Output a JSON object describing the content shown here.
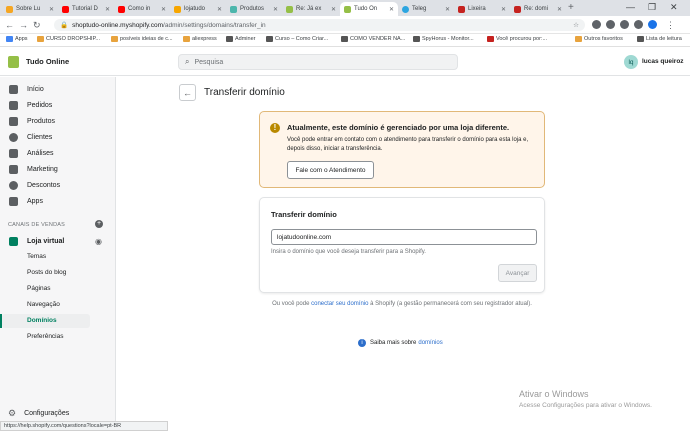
{
  "browser": {
    "tabs": [
      {
        "label": "Sobre Lu",
        "color": "#f5a623"
      },
      {
        "label": "Tutorial D",
        "color": "#ff0000"
      },
      {
        "label": "Como in",
        "color": "#ff0000"
      },
      {
        "label": "lojatudo",
        "color": "#f7a600"
      },
      {
        "label": "Produtos",
        "color": "#4cb6ac"
      },
      {
        "label": "Re: Já ex",
        "color": "#95bf47"
      },
      {
        "label": "Tudo On",
        "color": "#95bf47"
      },
      {
        "label": "Teleg",
        "color": "#2ca5e0"
      },
      {
        "label": "Lixeira",
        "color": "#c5221f"
      },
      {
        "label": "Re: domi",
        "color": "#c5221f"
      }
    ],
    "active_tab_index": 6,
    "url_domain": "shoptudo-online.myshopify.com",
    "url_path": "/admin/settings/domains/transfer_in",
    "bookmarks": [
      {
        "label": "Apps",
        "color": "#4285f4"
      },
      {
        "label": "CURSO DROPSHIP...",
        "color": "#e8a33d"
      },
      {
        "label": "posíveis ideias de c...",
        "color": "#e8a33d"
      },
      {
        "label": "aliexpress",
        "color": "#e8a33d"
      },
      {
        "label": "Adminer",
        "color": "#555555"
      },
      {
        "label": "Curso – Como Criar...",
        "color": "#555555"
      },
      {
        "label": "COMO VENDER NA...",
        "color": "#555555"
      },
      {
        "label": "SpyHorus - Monitor...",
        "color": "#555555"
      },
      {
        "label": "Você procurou por:...",
        "color": "#c5221f"
      },
      {
        "label": "Outros favoritos",
        "color": "#e8a33d"
      },
      {
        "label": "Lista de leitura",
        "color": "#555555"
      }
    ],
    "status_url": "https://help.shopify.com/questions?locale=pt-BR"
  },
  "topbar": {
    "store_name": "Tudo Online",
    "search_placeholder": "Pesquisa",
    "avatar_initials": "lq",
    "user_name": "lucas queiroz"
  },
  "sidebar": {
    "items": [
      {
        "label": "Início",
        "icon": "home-icon"
      },
      {
        "label": "Pedidos",
        "icon": "orders-icon"
      },
      {
        "label": "Produtos",
        "icon": "products-icon"
      },
      {
        "label": "Clientes",
        "icon": "customers-icon"
      },
      {
        "label": "Análises",
        "icon": "analytics-icon"
      },
      {
        "label": "Marketing",
        "icon": "marketing-icon"
      },
      {
        "label": "Descontos",
        "icon": "discounts-icon"
      },
      {
        "label": "Apps",
        "icon": "apps-icon"
      }
    ],
    "section_label": "CANAIS DE VENDAS",
    "channel_label": "Loja virtual",
    "channel_subitems": [
      "Temas",
      "Posts do blog",
      "Páginas",
      "Navegação",
      "Domínios",
      "Preferências"
    ],
    "active_subitem": "Domínios",
    "settings_label": "Configurações"
  },
  "page": {
    "title": "Transferir domínio",
    "banner": {
      "title": "Atualmente, este domínio é gerenciado por uma loja diferente.",
      "text": "Você pode entrar em contato com o atendimento para transferir o domínio para esta loja e, depois disso, iniciar a transferência.",
      "button": "Fale com o Atendimento"
    },
    "card": {
      "title": "Transferir domínio",
      "input_value": "lojatudoonline.com",
      "hint": "Insira o domínio que você deseja transferir para a Shopify.",
      "button": "Avançar"
    },
    "footer_before": "Ou você pode ",
    "footer_link": "conectar seu domínio",
    "footer_after": " à Shopify (a gestão permanecerá com seu registrador atual).",
    "learn_more_text": "Saiba mais sobre ",
    "learn_more_link": "domínios"
  },
  "watermark": {
    "line1": "Ativar o Windows",
    "line2": "Acesse Configurações para ativar o Windows."
  }
}
